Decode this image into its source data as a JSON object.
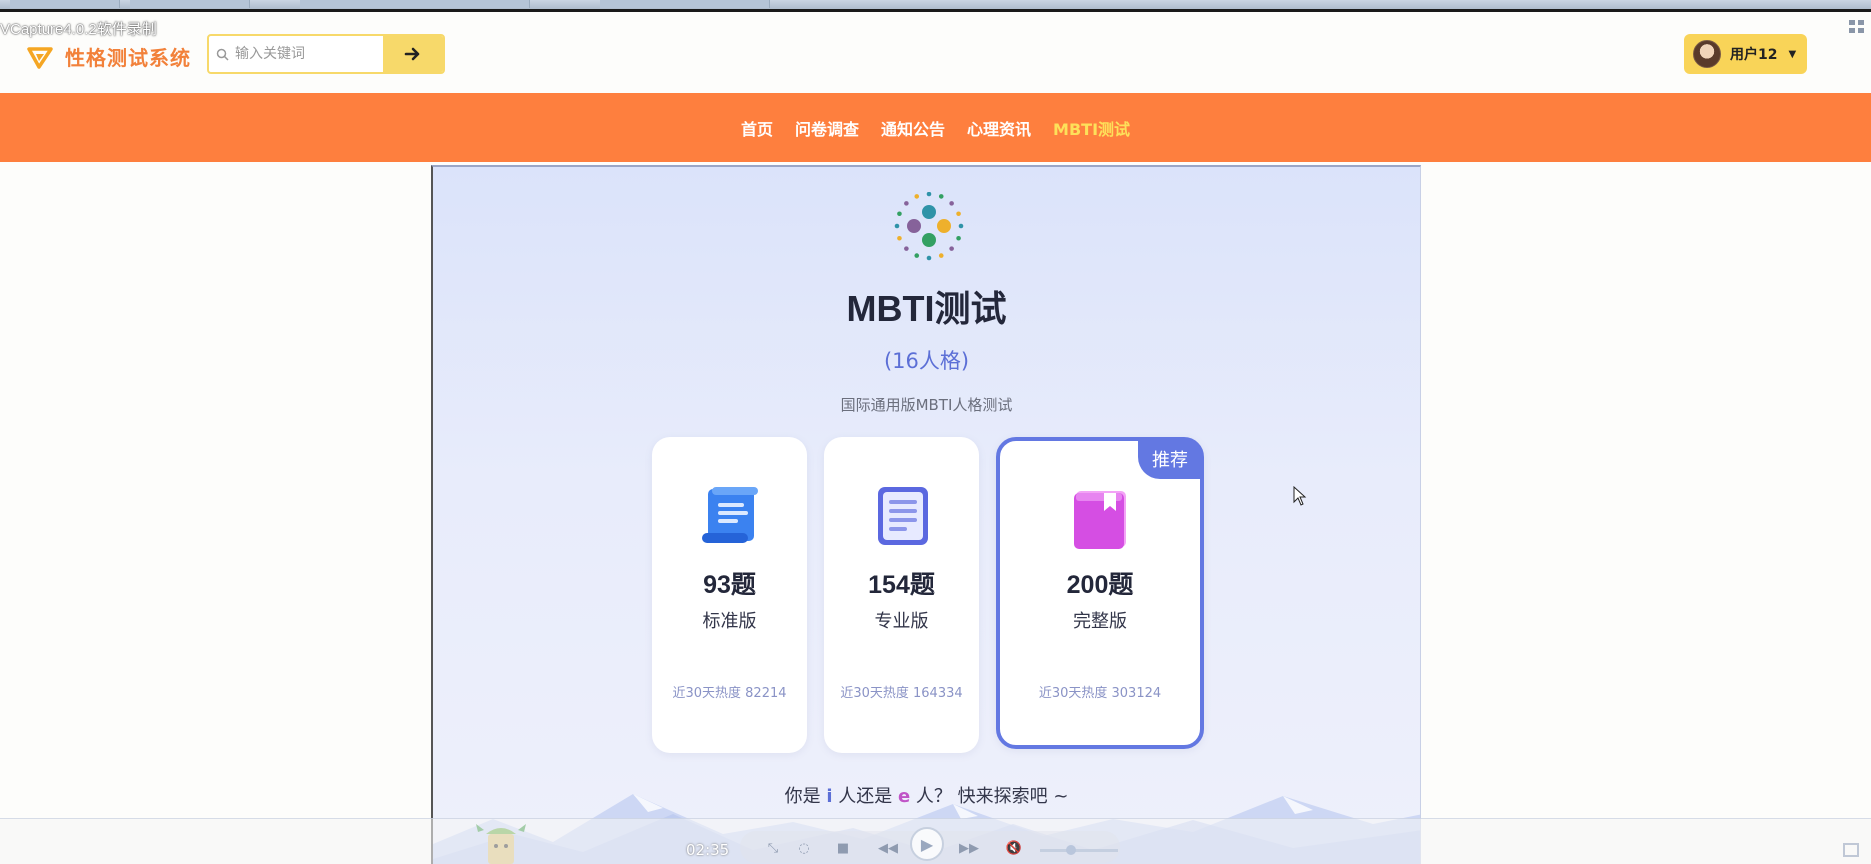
{
  "recorder": {
    "label": "VCapture4.0.2软件录制"
  },
  "header": {
    "app_title": "性格测试系统",
    "search": {
      "placeholder": "输入关键词",
      "value": ""
    },
    "user": {
      "name": "用户12"
    }
  },
  "nav": {
    "items": [
      {
        "label": "首页",
        "active": false
      },
      {
        "label": "问卷调查",
        "active": false
      },
      {
        "label": "通知公告",
        "active": false
      },
      {
        "label": "心理资讯",
        "active": false
      },
      {
        "label": "MBTI测试",
        "active": true
      }
    ]
  },
  "main": {
    "title": "MBTI测试",
    "subtitle": "(16人格)",
    "description": "国际通用版MBTI人格测试",
    "options": [
      {
        "count": "93题",
        "name": "标准版",
        "heat": "近30天热度 82214",
        "icon": "scroll-icon",
        "recommended": false
      },
      {
        "count": "154题",
        "name": "专业版",
        "heat": "近30天热度 164334",
        "icon": "clipboard-icon",
        "recommended": false
      },
      {
        "count": "200题",
        "name": "完整版",
        "heat": "近30天热度 303124",
        "icon": "book-icon",
        "recommended": true,
        "badge": "推荐"
      }
    ],
    "tagline": {
      "prefix": "你是 ",
      "i": "i",
      "middle": " 人还是 ",
      "e": "e",
      "suffix": " 人？ 快来探索吧 ~"
    }
  },
  "player": {
    "time": "02:35"
  },
  "colors": {
    "brand_orange": "#fe7f3e",
    "accent_yellow": "#f9d458",
    "nav_active": "#fde05a",
    "recommended_blue": "#6378e2"
  }
}
